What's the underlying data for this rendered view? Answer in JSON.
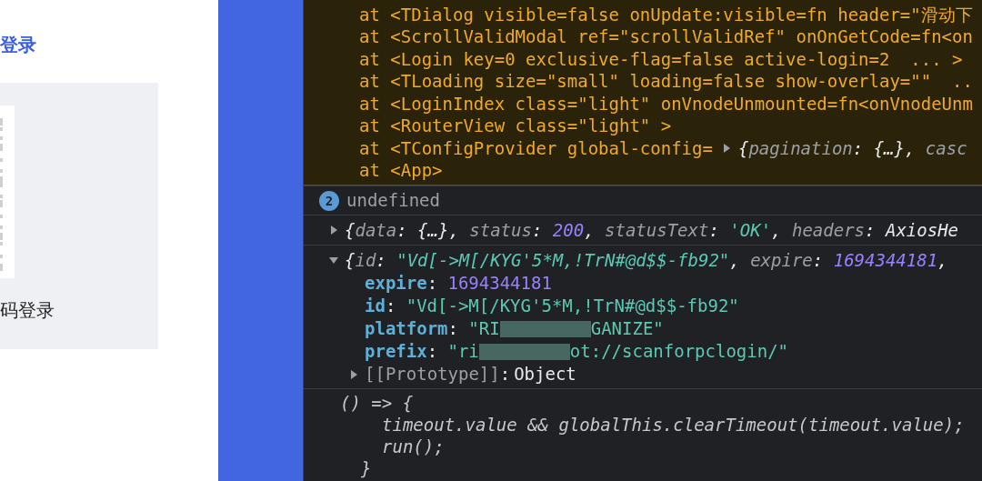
{
  "login_panel": {
    "tab_title": "登录",
    "qr_caption": "码登录"
  },
  "console": {
    "key_separator": ":",
    "warning": {
      "lines": [
        "at <TDialog visible=false onUpdate:visible=fn header=\"滑动下",
        "at <ScrollValidModal ref=\"scrollValidRef\" onOnGetCode=fn<on",
        "at <Login key=0 exclusive-flag=false active-login=2  ... >",
        "at <TLoading size=\"small\" loading=false show-overlay=\"\"  ..",
        "at <LoginIndex class=\"light\" onVnodeUnmounted=fn<onVnodeUnm",
        "at <RouterView class=\"light\" >"
      ],
      "config_line": {
        "text": "at <TConfigProvider global-config=",
        "expanded": false,
        "preview": [
          {
            "kind": "punct",
            "text": "{"
          },
          {
            "kind": "key",
            "text": "pagination"
          },
          {
            "kind": "punct",
            "text": ": {…}, "
          },
          {
            "kind": "key",
            "text": "casc"
          }
        ]
      },
      "last_line": "at <App>"
    },
    "messages": [
      {
        "kind": "log",
        "badge": "2",
        "text": "undefined"
      },
      {
        "kind": "object",
        "expanded": false,
        "preview": [
          {
            "kind": "punct",
            "text": "{"
          },
          {
            "kind": "key",
            "text": "data"
          },
          {
            "kind": "punct",
            "text": ": {…}, "
          },
          {
            "kind": "key",
            "text": "status"
          },
          {
            "kind": "punct",
            "text": ": "
          },
          {
            "kind": "number",
            "text": "200"
          },
          {
            "kind": "punct",
            "text": ", "
          },
          {
            "kind": "key",
            "text": "statusText"
          },
          {
            "kind": "punct",
            "text": ": "
          },
          {
            "kind": "string",
            "text": "'OK'"
          },
          {
            "kind": "punct",
            "text": ", "
          },
          {
            "kind": "key",
            "text": "headers"
          },
          {
            "kind": "punct",
            "text": ": AxiosHe"
          }
        ]
      },
      {
        "kind": "object",
        "expanded": true,
        "preview": [
          {
            "kind": "punct",
            "text": "{"
          },
          {
            "kind": "key",
            "text": "id"
          },
          {
            "kind": "punct",
            "text": ": "
          },
          {
            "kind": "string",
            "text": "\"Vd[->M[/KYG'5*M,!TrN#@d$$-fb92\""
          },
          {
            "kind": "punct",
            "text": ", "
          },
          {
            "kind": "key",
            "text": "expire"
          },
          {
            "kind": "punct",
            "text": ": "
          },
          {
            "kind": "number",
            "text": "1694344181"
          },
          {
            "kind": "punct",
            "text": ","
          }
        ],
        "properties": [
          {
            "key": "expire",
            "value": [
              {
                "kind": "number",
                "text": "1694344181"
              }
            ]
          },
          {
            "key": "id",
            "value": [
              {
                "kind": "string",
                "text": "\"Vd[->M[/KYG'5*M,!TrN#@d$$-fb92\""
              }
            ]
          },
          {
            "key": "platform",
            "value": [
              {
                "kind": "string",
                "text": "\"RI"
              },
              {
                "kind": "redacted"
              },
              {
                "kind": "string",
                "text": "GANIZE\""
              }
            ]
          },
          {
            "key": "prefix",
            "value": [
              {
                "kind": "string",
                "text": "\"ri"
              },
              {
                "kind": "redacted"
              },
              {
                "kind": "string",
                "text": "ot://scanforpclogin/\""
              }
            ]
          }
        ],
        "prototype": {
          "label": "[[Prototype]]",
          "value": "Object",
          "expanded": false
        }
      },
      {
        "kind": "function",
        "opening": "() => {",
        "body": [
          "timeout.value && globalThis.clearTimeout(timeout.value);",
          "run();"
        ],
        "closing": "}"
      }
    ]
  }
}
